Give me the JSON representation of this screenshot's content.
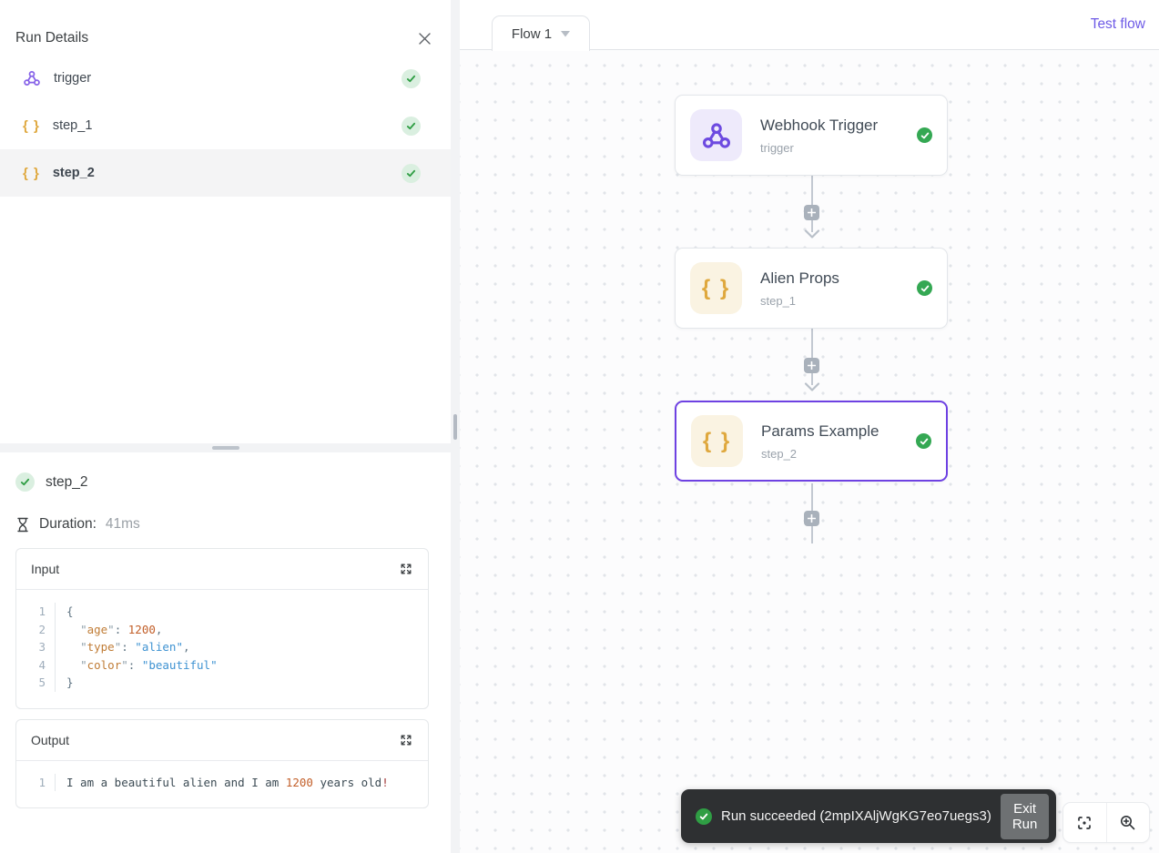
{
  "colors": {
    "accent_purple": "#6e41e2",
    "success_green": "#34a853",
    "braces_yellow": "#dfa83e",
    "toast_background": "#2e3032"
  },
  "run_details_panel": {
    "title": "Run Details",
    "steps": [
      {
        "label": "trigger",
        "icon": "webhook-icon",
        "status": "success",
        "selected": false
      },
      {
        "label": "step_1",
        "icon": "braces-icon",
        "status": "success",
        "selected": false
      },
      {
        "label": "step_2",
        "icon": "braces-icon",
        "status": "success",
        "selected": true
      }
    ]
  },
  "step_details_panel": {
    "step_name": "step_2",
    "duration_label": "Duration:",
    "duration_value": "41ms",
    "input_panel": {
      "title": "Input",
      "code_lines": [
        {
          "num": "1",
          "segments": [
            {
              "t": "{",
              "c": "punct"
            }
          ]
        },
        {
          "num": "2",
          "segments": [
            {
              "t": "  ",
              "c": "plain"
            },
            {
              "t": "\"",
              "c": "q"
            },
            {
              "t": "age",
              "c": "key"
            },
            {
              "t": "\"",
              "c": "q"
            },
            {
              "t": ": ",
              "c": "punct"
            },
            {
              "t": "1200",
              "c": "num"
            },
            {
              "t": ",",
              "c": "punct"
            }
          ]
        },
        {
          "num": "3",
          "segments": [
            {
              "t": "  ",
              "c": "plain"
            },
            {
              "t": "\"",
              "c": "q"
            },
            {
              "t": "type",
              "c": "key"
            },
            {
              "t": "\"",
              "c": "q"
            },
            {
              "t": ": ",
              "c": "punct"
            },
            {
              "t": "\"alien\"",
              "c": "str"
            },
            {
              "t": ",",
              "c": "punct"
            }
          ]
        },
        {
          "num": "4",
          "segments": [
            {
              "t": "  ",
              "c": "plain"
            },
            {
              "t": "\"",
              "c": "q"
            },
            {
              "t": "color",
              "c": "key"
            },
            {
              "t": "\"",
              "c": "q"
            },
            {
              "t": ": ",
              "c": "punct"
            },
            {
              "t": "\"beautiful\"",
              "c": "str"
            }
          ]
        },
        {
          "num": "5",
          "segments": [
            {
              "t": "}",
              "c": "punct"
            }
          ]
        }
      ]
    },
    "output_panel": {
      "title": "Output",
      "code_lines": [
        {
          "num": "1",
          "segments": [
            {
              "t": "I am a beautiful alien and I am ",
              "c": "plain"
            },
            {
              "t": "1200",
              "c": "num"
            },
            {
              "t": " years old",
              "c": "plain"
            },
            {
              "t": "!",
              "c": "excl"
            }
          ]
        }
      ]
    }
  },
  "flow_header": {
    "tab_label": "Flow 1",
    "test_flow_label": "Test flow"
  },
  "canvas": {
    "nodes": [
      {
        "title": "Webhook Trigger",
        "subtitle": "trigger",
        "icon": "webhook-icon",
        "status": "success",
        "selected": false
      },
      {
        "title": "Alien Props",
        "subtitle": "step_1",
        "icon": "braces-icon",
        "status": "success",
        "selected": false
      },
      {
        "title": "Params Example",
        "subtitle": "step_2",
        "icon": "braces-icon",
        "status": "success",
        "selected": true
      }
    ]
  },
  "toast": {
    "message": "Run succeeded (2mpIXAljWgKG7eo7uegs3)",
    "exit_button_label": "Exit Run"
  }
}
